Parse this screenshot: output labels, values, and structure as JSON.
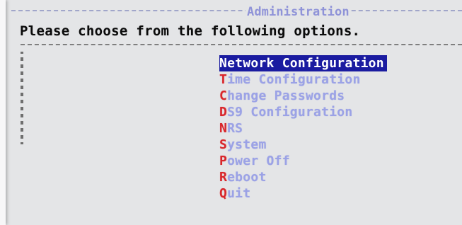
{
  "window": {
    "title": "Administration"
  },
  "prompt": {
    "text": "Please choose from the following options."
  },
  "menu": {
    "selected_index": 0,
    "items": [
      {
        "hotkey": "N",
        "rest": "etwork Configuration"
      },
      {
        "hotkey": "T",
        "rest": "ime Configuration"
      },
      {
        "hotkey": "C",
        "rest": "hange Passwords"
      },
      {
        "hotkey": "D",
        "rest": "S9 Configuration"
      },
      {
        "hotkey": "N",
        "rest": "RS"
      },
      {
        "hotkey": "S",
        "rest": "ystem"
      },
      {
        "hotkey": "P",
        "rest": "ower Off"
      },
      {
        "hotkey": "R",
        "rest": "eboot"
      },
      {
        "hotkey": "Q",
        "rest": "uit"
      }
    ]
  },
  "colors": {
    "background": "#e4e5e7",
    "title": "#8f93d8",
    "menu_text": "#9ba2e6",
    "hotkey": "#d9262b",
    "selection_background": "#1a1ba0",
    "selection_text": "#ffffff"
  }
}
